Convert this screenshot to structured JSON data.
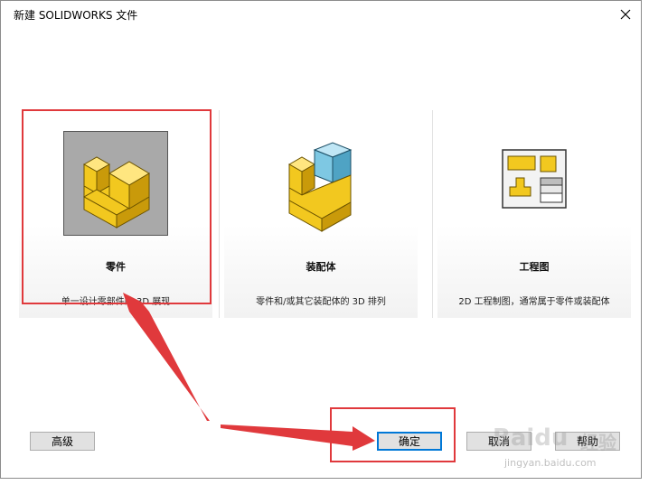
{
  "window": {
    "title": "新建 SOLIDWORKS 文件"
  },
  "templates": [
    {
      "name": "零件",
      "description": "单一设计零部件的 3D 展现",
      "icon": "part-icon",
      "selected": true
    },
    {
      "name": "装配体",
      "description": "零件和/或其它装配体的 3D 排列",
      "icon": "assembly-icon",
      "selected": false
    },
    {
      "name": "工程图",
      "description": "2D 工程制图，通常属于零件或装配体",
      "icon": "drawing-icon",
      "selected": false
    }
  ],
  "buttons": {
    "advanced": "高级",
    "ok": "确定",
    "cancel": "取消",
    "help": "帮助"
  },
  "watermark": {
    "brand": "Baidu",
    "text": "经验",
    "url": "jingyan.baidu.com"
  },
  "colors": {
    "highlight": "#e0393c",
    "selected_bg": "#a9a9a9",
    "part_yellow": "#f2c81f",
    "assembly_blue": "#7ec8e3",
    "focus_blue": "#0078d7"
  }
}
